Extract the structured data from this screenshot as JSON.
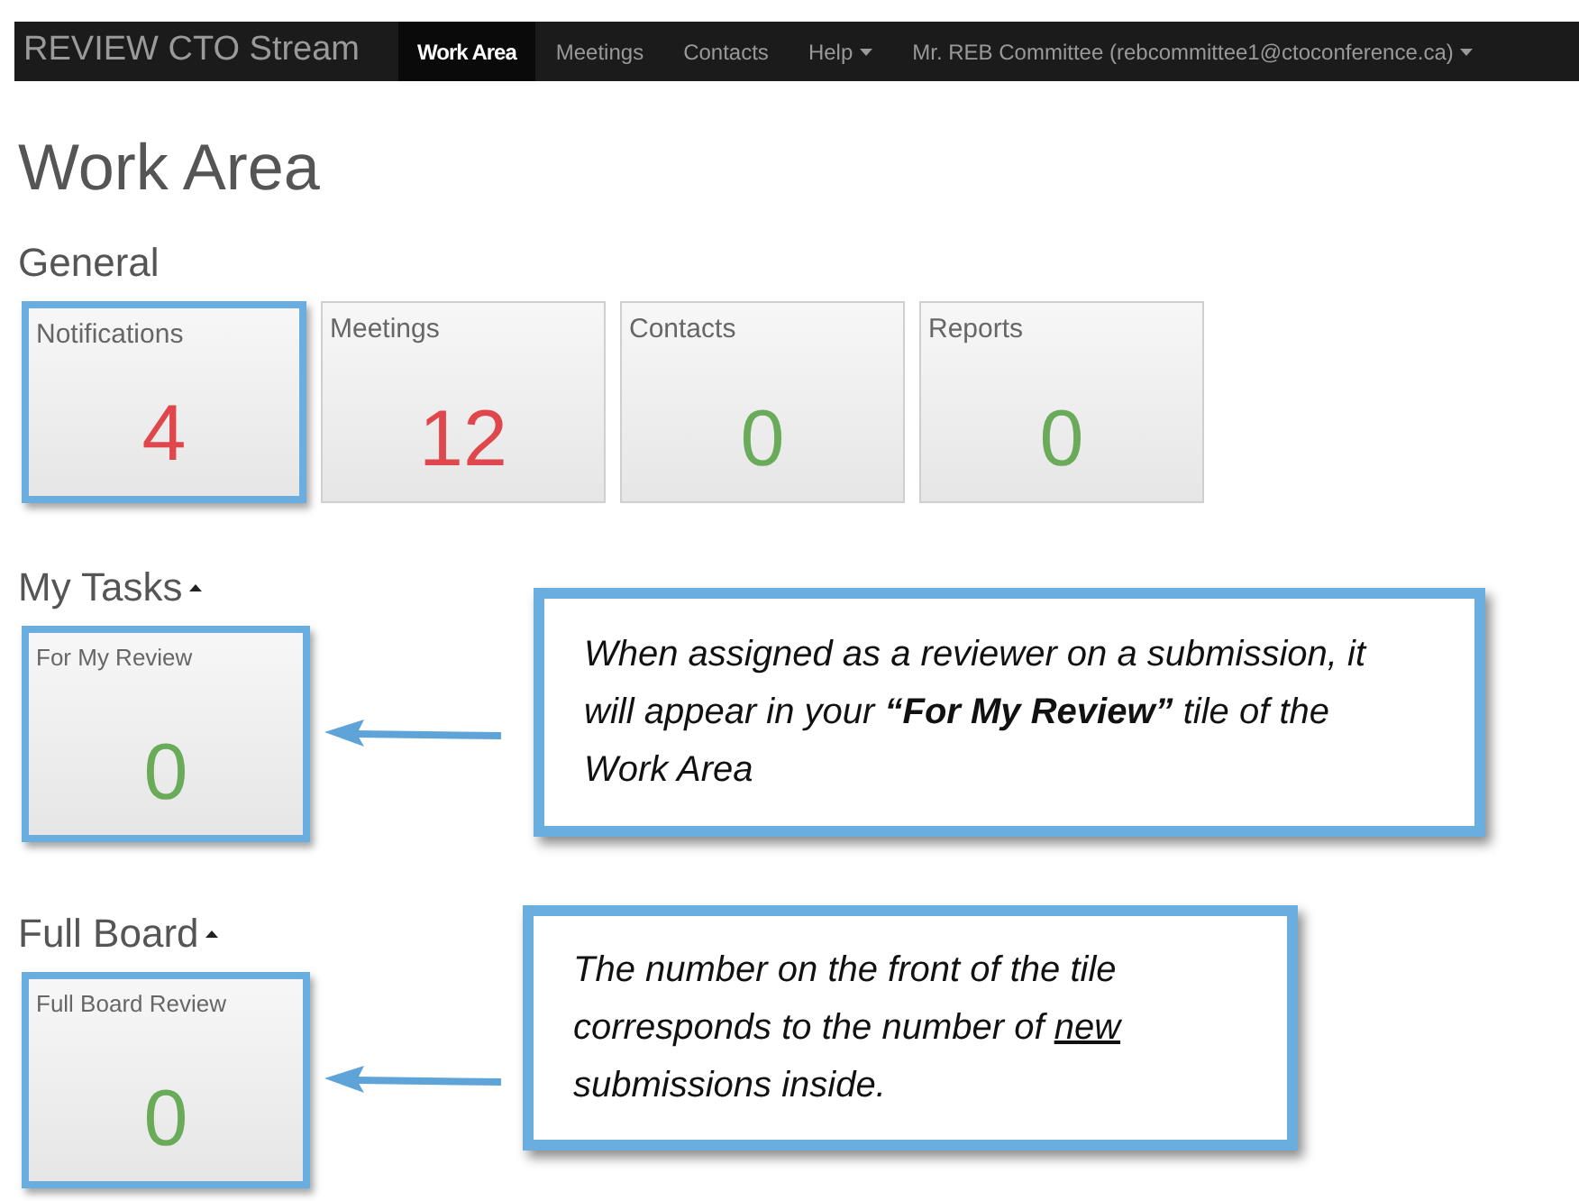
{
  "navbar": {
    "brand": "REVIEW CTO Stream",
    "items": [
      {
        "label": "Work Area",
        "selected": true,
        "has_caret": false
      },
      {
        "label": "Meetings",
        "selected": false,
        "has_caret": false
      },
      {
        "label": "Contacts",
        "selected": false,
        "has_caret": false
      },
      {
        "label": "Help",
        "selected": false,
        "has_caret": true
      },
      {
        "label": "Mr. REB Committee (rebcommittee1@ctoconference.ca)",
        "selected": false,
        "has_caret": true
      }
    ]
  },
  "page_title": "Work Area",
  "sections": [
    {
      "title": "General",
      "tiles": [
        {
          "label": "Notifications",
          "count": "4",
          "color": "#e0474c",
          "highlighted": true
        },
        {
          "label": "Meetings",
          "count": "12",
          "color": "#e0474c",
          "highlighted": false
        },
        {
          "label": "Contacts",
          "count": "0",
          "color": "#6aab5a",
          "highlighted": false
        },
        {
          "label": "Reports",
          "count": "0",
          "color": "#6aab5a",
          "highlighted": false
        }
      ]
    },
    {
      "title": "My Tasks",
      "expanded": true,
      "tiles": [
        {
          "label": "For My Review",
          "count": "0",
          "color": "#6aab5a",
          "highlighted": true
        }
      ],
      "callout": [
        {
          "text": "When assigned as a reviewer on a submission, it will appear in your **“For My Review”** tile of the Work Area",
          "underline": false
        }
      ]
    },
    {
      "title": "Full Board",
      "expanded": true,
      "tiles": [
        {
          "label": "Full Board Review",
          "count": "0",
          "color": "#6aab5a",
          "highlighted": true
        }
      ],
      "callout": [
        {
          "text": "The number on the front of the tile corresponds to the number of ",
          "underline": false
        },
        {
          "text": "new",
          "underline": true
        },
        {
          "text": " submissions inside.",
          "underline": false
        }
      ]
    }
  ]
}
